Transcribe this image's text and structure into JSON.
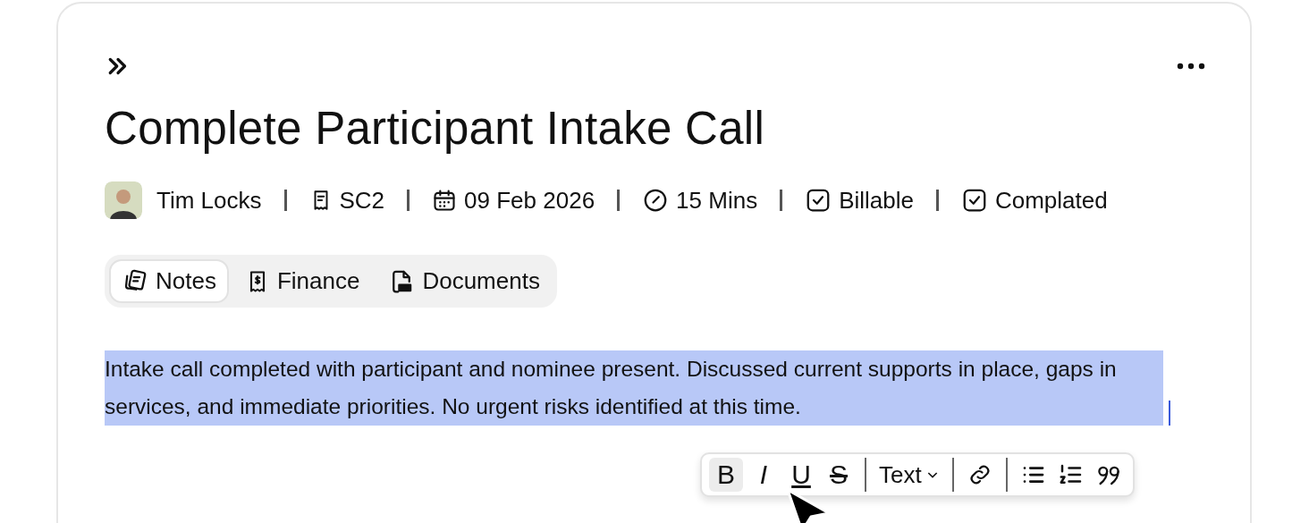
{
  "header": {
    "title": "Complete Participant Intake Call"
  },
  "meta": [
    {
      "kind": "person",
      "label": "Tim Locks"
    },
    {
      "kind": "receipt",
      "label": "SC2"
    },
    {
      "kind": "date",
      "label": "09 Feb 2026"
    },
    {
      "kind": "clock",
      "label": "15 Mins"
    },
    {
      "kind": "check",
      "label": "Billable",
      "checked": true
    },
    {
      "kind": "check",
      "label": "Complated",
      "checked": true
    }
  ],
  "tabs": [
    {
      "label": "Notes",
      "kind": "notes",
      "selected": true
    },
    {
      "label": "Finance",
      "kind": "finance",
      "selected": false
    },
    {
      "label": "Documents",
      "kind": "pdf",
      "selected": false
    }
  ],
  "note": {
    "text": "Intake call completed with participant and nominee present. Discussed current supports in place, gaps in services,  and immediate priorities. No urgent risks identified at this time.",
    "selected": true
  },
  "toolbar": [
    {
      "kind": "bold",
      "label": "B",
      "selected": true
    },
    {
      "kind": "italic",
      "label": "I",
      "selected": false
    },
    {
      "kind": "underline",
      "label": "U",
      "selected": false
    },
    {
      "kind": "strike",
      "label": "S",
      "selected": false
    },
    {
      "kind": "divider"
    },
    {
      "kind": "dropdown",
      "label": "Text"
    },
    {
      "kind": "divider"
    },
    {
      "kind": "link"
    },
    {
      "kind": "divider"
    },
    {
      "kind": "bullets"
    },
    {
      "kind": "numbers"
    },
    {
      "kind": "quote"
    }
  ]
}
